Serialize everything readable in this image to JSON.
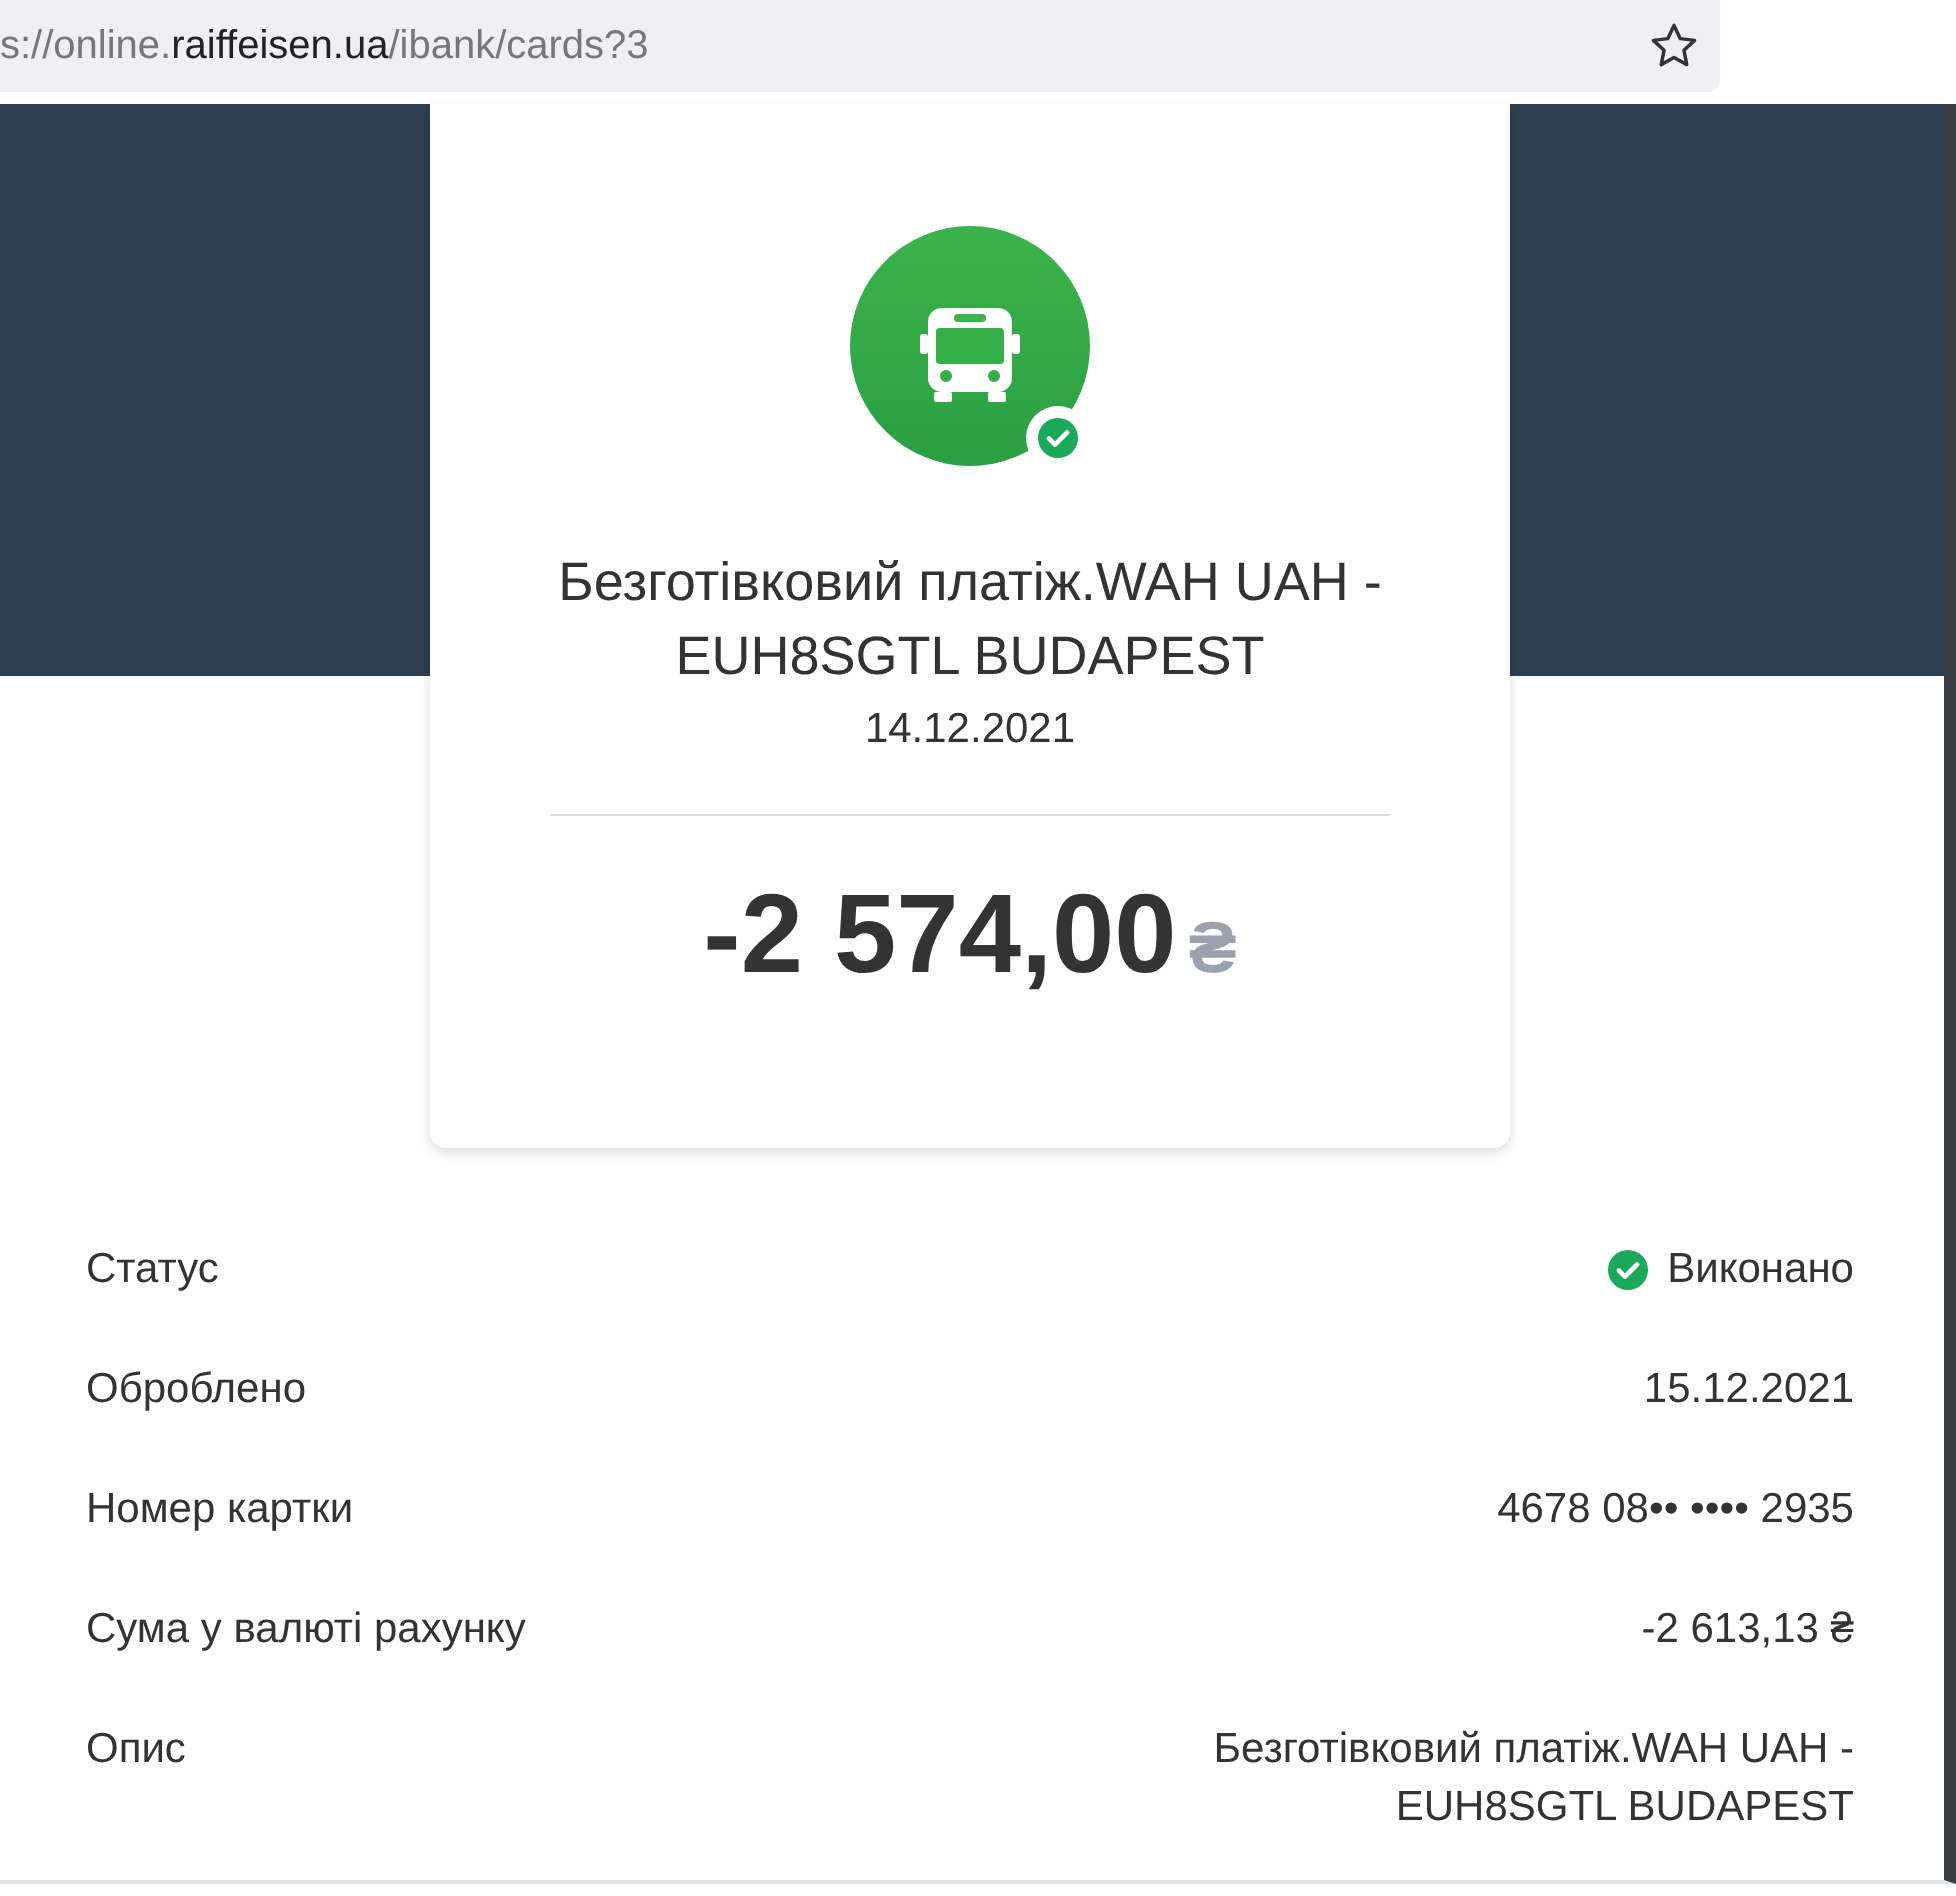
{
  "address_bar": {
    "url_start": "s://online.",
    "url_domain": "raiffeisen.ua",
    "url_end": "/ibank/cards?3"
  },
  "transaction": {
    "title": "Безготівковий платіж.WAH UAH - EUH8SGTL BUDAPEST",
    "date": "14.12.2021",
    "amount": "-2 574,00",
    "currency": "₴",
    "completed": true
  },
  "details": [
    {
      "label": "Статус",
      "value": "Виконано",
      "kind": "status"
    },
    {
      "label": "Оброблено",
      "value": "15.12.2021",
      "kind": "text"
    },
    {
      "label": "Номер картки",
      "value": "4678 08•• •••• 2935",
      "kind": "text"
    },
    {
      "label": "Сума у валюті рахунку",
      "value": "-2 613,13 ₴",
      "kind": "text"
    },
    {
      "label": "Опис",
      "value": "Безготівковий платіж.WAH UAH - EUH8SGTL BUDAPEST",
      "kind": "text"
    }
  ]
}
